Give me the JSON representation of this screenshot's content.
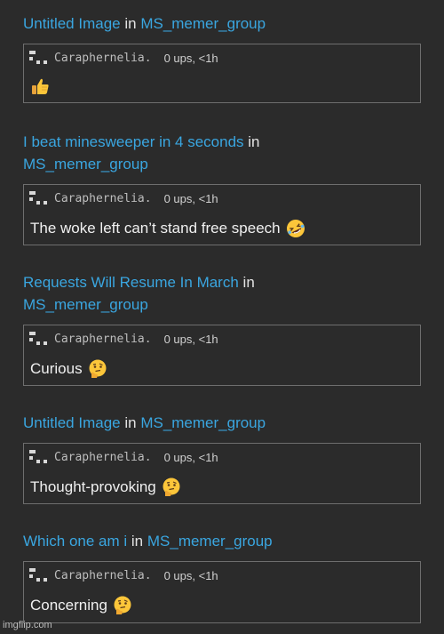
{
  "posts": [
    {
      "title": "Untitled Image",
      "connector": " in ",
      "group": "MS_memer_group",
      "username": "Caraphernelia.",
      "stats": "0 ups, <1h",
      "text": "",
      "emoji": "thumbs-up-emoji"
    },
    {
      "title": "I beat minesweeper in 4 seconds",
      "connector": " in",
      "group": "MS_memer_group",
      "username": "Caraphernelia.",
      "stats": "0 ups, <1h",
      "text": "The woke left can’t stand free speech",
      "emoji": "rolling-laughing-emoji"
    },
    {
      "title": "Requests Will Resume In March",
      "connector": " in",
      "group": "MS_memer_group",
      "username": "Caraphernelia.",
      "stats": "0 ups, <1h",
      "text": "Curious",
      "emoji": "thinking-face-emoji"
    },
    {
      "title": "Untitled Image",
      "connector": " in ",
      "group": "MS_memer_group",
      "username": "Caraphernelia.",
      "stats": "0 ups, <1h",
      "text": "Thought-provoking",
      "emoji": "thinking-face-emoji"
    },
    {
      "title": "Which one am i",
      "connector": " in ",
      "group": "MS_memer_group",
      "username": "Caraphernelia.",
      "stats": "0 ups, <1h",
      "text": "Concerning",
      "emoji": "thinking-face-emoji"
    }
  ],
  "watermark": "imgflip.com",
  "colors": {
    "background": "#2b2b2b",
    "link": "#3aa6e0",
    "card_border": "#6e6e6e"
  }
}
